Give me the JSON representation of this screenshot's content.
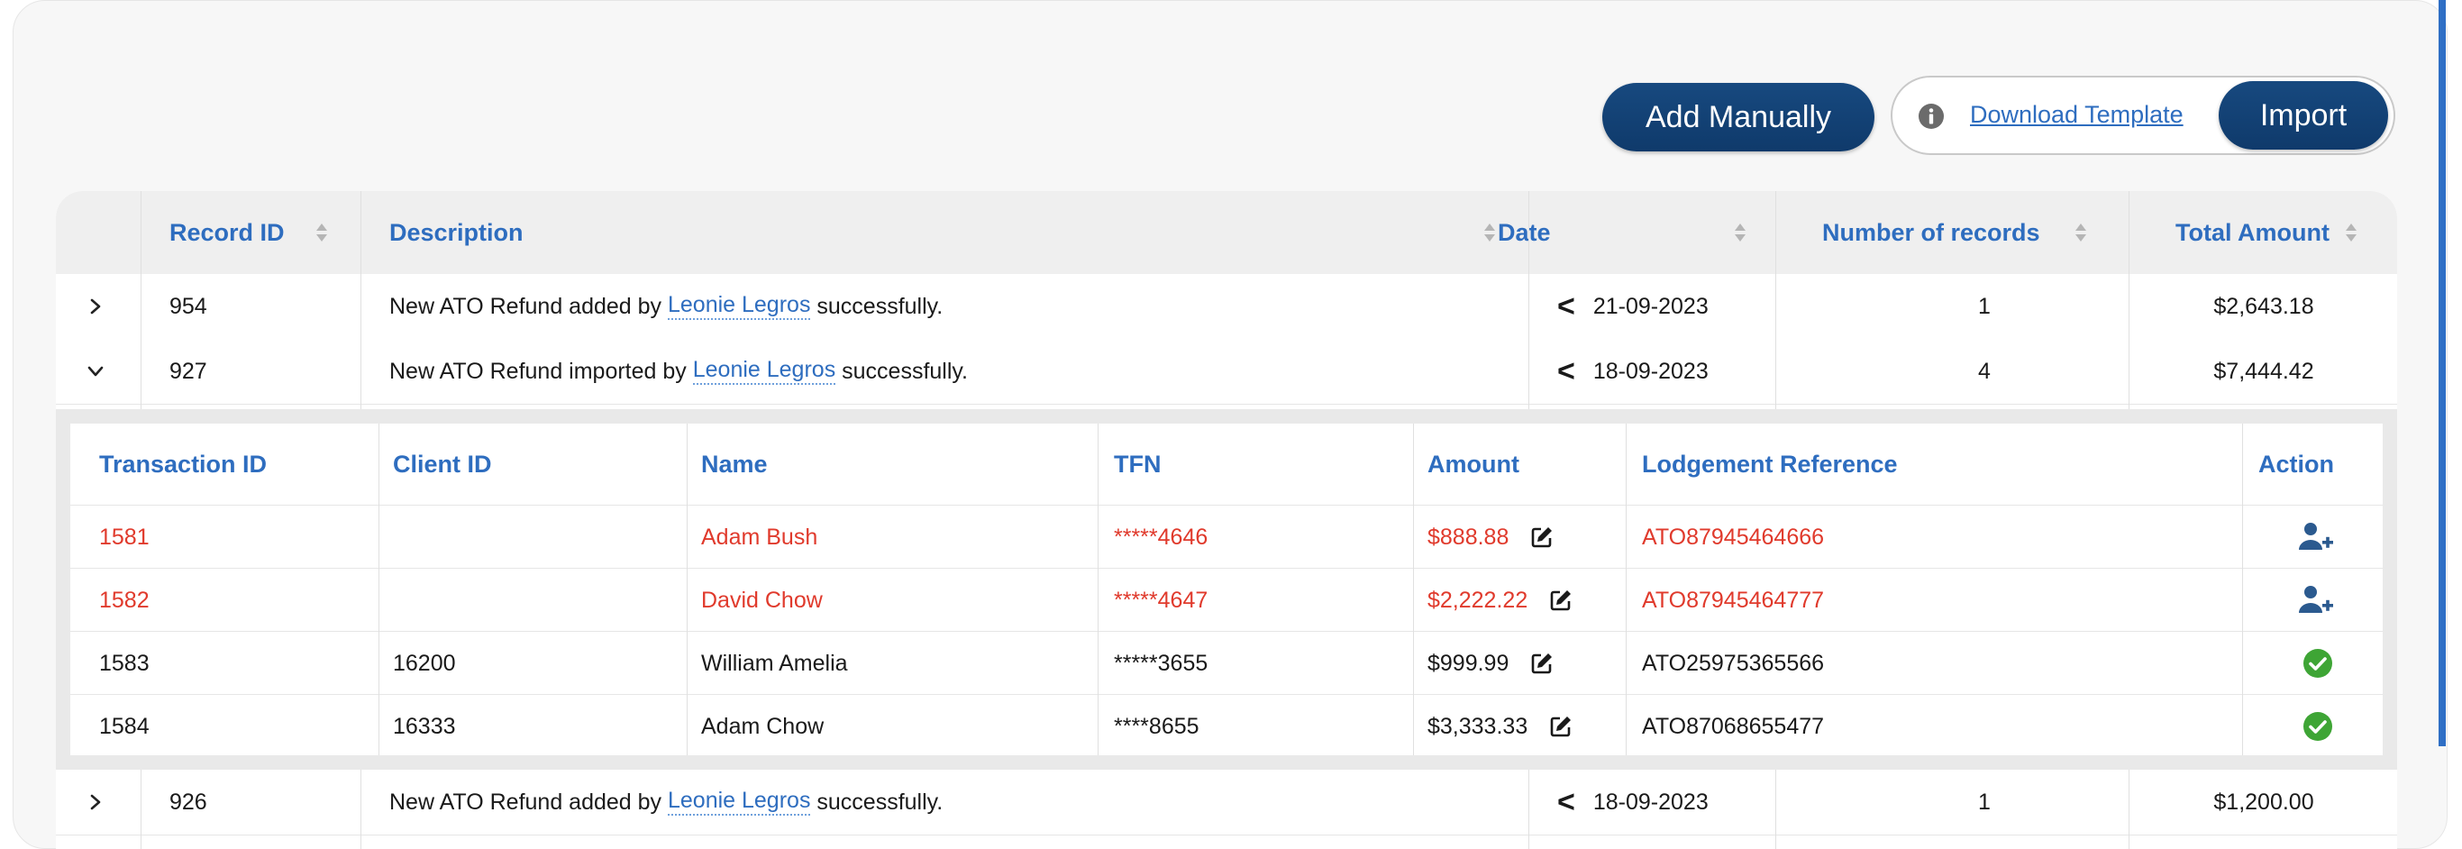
{
  "toolbar": {
    "add_manually": "Add Manually",
    "download_template": "Download Template",
    "import": "Import"
  },
  "columns": {
    "record_id": "Record ID",
    "description": "Description",
    "date": "Date",
    "num_records": "Number of records",
    "total_amount": "Total Amount"
  },
  "records": [
    {
      "id": "954",
      "desc_prefix": "New ATO Refund added by ",
      "user": "Leonie Legros",
      "desc_suffix": " successfully.",
      "date": "21-09-2023",
      "count": "1",
      "total": "$2,643.18",
      "expanded": false
    },
    {
      "id": "927",
      "desc_prefix": "New ATO Refund imported by ",
      "user": "Leonie Legros",
      "desc_suffix": " successfully.",
      "date": "18-09-2023",
      "count": "4",
      "total": "$7,444.42",
      "expanded": true
    },
    {
      "id": "926",
      "desc_prefix": "New ATO Refund added by ",
      "user": "Leonie Legros",
      "desc_suffix": " successfully.",
      "date": "18-09-2023",
      "count": "1",
      "total": "$1,200.00",
      "expanded": false
    }
  ],
  "sub_columns": {
    "transaction_id": "Transaction ID",
    "client_id": "Client ID",
    "name": "Name",
    "tfn": "TFN",
    "amount": "Amount",
    "lodgement_reference": "Lodgement Reference",
    "action": "Action"
  },
  "transactions": [
    {
      "id": "1581",
      "client_id": "",
      "name": "Adam Bush",
      "tfn": "*****4646",
      "amount": "$888.88",
      "ref": "ATO87945464666",
      "status": "unmatched"
    },
    {
      "id": "1582",
      "client_id": "",
      "name": "David Chow",
      "tfn": "*****4647",
      "amount": "$2,222.22",
      "ref": "ATO87945464777",
      "status": "unmatched"
    },
    {
      "id": "1583",
      "client_id": "16200",
      "name": "William Amelia",
      "tfn": "*****3655",
      "amount": "$999.99",
      "ref": "ATO25975365566",
      "status": "matched"
    },
    {
      "id": "1584",
      "client_id": "16333",
      "name": "Adam Chow",
      "tfn": "****8655",
      "amount": "$3,333.33",
      "ref": "ATO87068655477",
      "status": "matched"
    }
  ],
  "colors": {
    "primary": "#0f3a6b",
    "link": "#2e6dbf",
    "error": "#e03a2c",
    "success": "#3ea535"
  },
  "icons": [
    "info-icon",
    "sort-icon",
    "chevron-right-icon",
    "chevron-down-icon",
    "date-less-than-icon",
    "edit-icon",
    "add-user-icon",
    "check-circle-icon"
  ]
}
